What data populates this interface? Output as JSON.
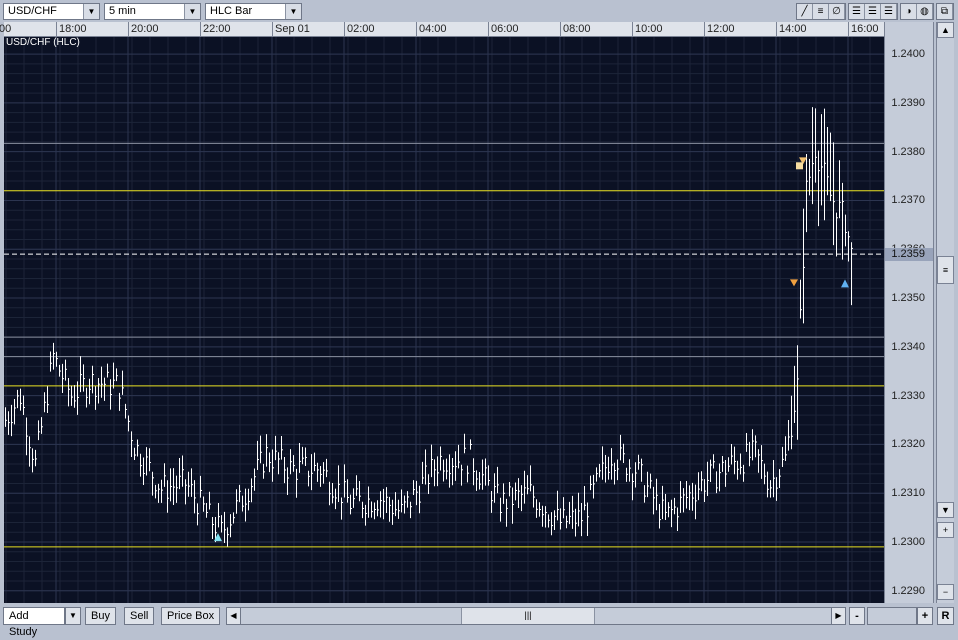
{
  "toolbar": {
    "symbol": "USD/CHF",
    "interval": "5 min",
    "chart_type": "HLC Bar",
    "tools": [
      "line-tool-icon",
      "horizontal-line-icon",
      "cancel-drawing-icon",
      "grid-fine-icon",
      "grid-medium-icon",
      "grid-coarse-icon",
      "color-scheme-icon",
      "pattern-icon",
      "detach-window-icon"
    ]
  },
  "chart_title": "USD/CHF (HLC)",
  "chart_data": {
    "type": "hlc-bar",
    "title": "USD/CHF (HLC)",
    "time_labels": [
      "00",
      "18:00",
      "20:00",
      "22:00",
      "Sep 01",
      "02:00",
      "04:00",
      "06:00",
      "08:00",
      "10:00",
      "12:00",
      "14:00",
      "16:00"
    ],
    "price_labels": [
      "1.2400",
      "1.2390",
      "1.2380",
      "1.2370",
      "1.2360",
      "1.2350",
      "1.2340",
      "1.2330",
      "1.2320",
      "1.2310",
      "1.2300",
      "1.2290"
    ],
    "ylim": [
      1.22875,
      1.24035
    ],
    "interval_minutes": 5,
    "close_anchors": [
      [
        0,
        1.2325
      ],
      [
        5,
        1.233
      ],
      [
        10,
        1.2316
      ],
      [
        16,
        1.2338
      ],
      [
        22,
        1.233
      ],
      [
        28,
        1.2333
      ],
      [
        38,
        1.2332
      ],
      [
        43,
        1.232
      ],
      [
        52,
        1.2311
      ],
      [
        60,
        1.2312
      ],
      [
        68,
        1.2305
      ],
      [
        72,
        1.2302
      ],
      [
        80,
        1.231
      ],
      [
        87,
        1.2318
      ],
      [
        95,
        1.2315
      ],
      [
        105,
        1.2315
      ],
      [
        115,
        1.2308
      ],
      [
        125,
        1.2309
      ],
      [
        132,
        1.2306
      ],
      [
        145,
        1.2317
      ],
      [
        155,
        1.2317
      ],
      [
        165,
        1.2308
      ],
      [
        175,
        1.231
      ],
      [
        185,
        1.2304
      ],
      [
        192,
        1.2305
      ],
      [
        202,
        1.2318
      ],
      [
        210,
        1.2315
      ],
      [
        220,
        1.2305
      ],
      [
        232,
        1.2312
      ],
      [
        242,
        1.2316
      ],
      [
        250,
        1.2318
      ],
      [
        255,
        1.2312
      ],
      [
        260,
        1.2317
      ],
      [
        264,
        1.2332
      ],
      [
        267,
        1.2372
      ],
      [
        270,
        1.2381
      ],
      [
        275,
        1.2371
      ],
      [
        280,
        1.2366
      ],
      [
        282,
        1.2359
      ]
    ],
    "current_price": "1.2359",
    "horizontal_lines": [
      {
        "price": 1.2372,
        "color": "#e8e020"
      },
      {
        "price": 1.2332,
        "color": "#e8e020"
      },
      {
        "price": 1.2299,
        "color": "#e8e020"
      },
      {
        "price": 1.23817,
        "color": "#8a90a0"
      },
      {
        "price": 1.2342,
        "color": "#8a90a0"
      },
      {
        "price": 1.2338,
        "color": "#8a90a0"
      }
    ],
    "markers": [
      {
        "bar": 263,
        "price": 1.2353,
        "kind": "sell",
        "color": "#f0a040"
      },
      {
        "bar": 266,
        "price": 1.2378,
        "kind": "sell",
        "color": "#f0c070"
      },
      {
        "bar": 265,
        "price": 1.2377,
        "kind": "order",
        "color": "#f5dca0"
      },
      {
        "bar": 280,
        "price": 1.2353,
        "kind": "buy",
        "color": "#60b0f0"
      },
      {
        "bar": 71,
        "price": 1.2301,
        "kind": "buy",
        "color": "#80e0f0"
      }
    ]
  },
  "bottom": {
    "add_study": "Add Study",
    "buy": "Buy",
    "sell": "Sell",
    "price_box": "Price Box",
    "zoom_out": "-",
    "zoom_in": "+",
    "reset": "R"
  }
}
